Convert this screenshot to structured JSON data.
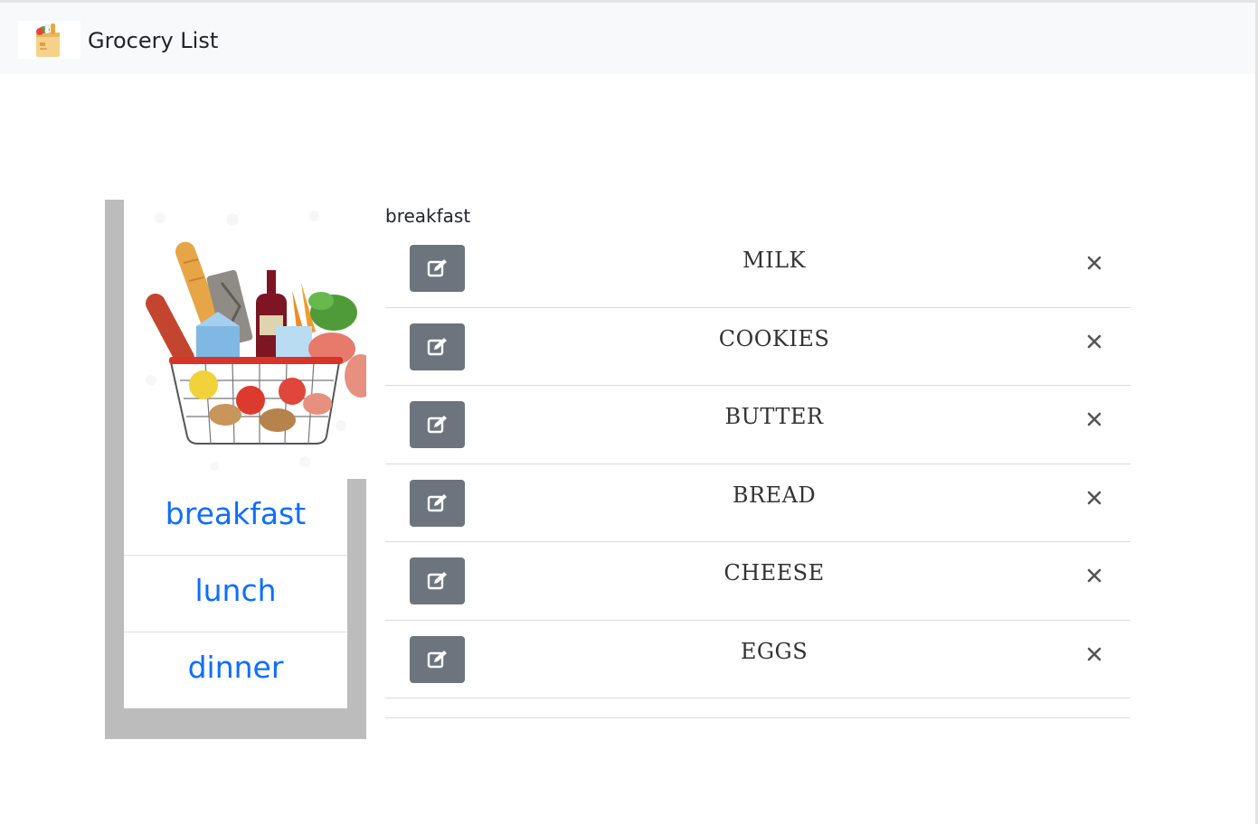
{
  "app": {
    "title": "Grocery List"
  },
  "sidebar": {
    "categories": [
      {
        "label": "breakfast"
      },
      {
        "label": "lunch"
      },
      {
        "label": "dinner"
      }
    ]
  },
  "main": {
    "list_title": "breakfast",
    "items": [
      {
        "name": "MILK"
      },
      {
        "name": "COOKIES"
      },
      {
        "name": "BUTTER"
      },
      {
        "name": "BREAD"
      },
      {
        "name": "CHEESE"
      },
      {
        "name": "EGGS"
      }
    ]
  },
  "colors": {
    "navbar_bg": "#f8f9fa",
    "sidebar_frame": "#bcbcbc",
    "link": "#0d6efd",
    "edit_button": "#6c757d",
    "delete_icon": "#555555"
  },
  "icons": {
    "brand": "grocery-bag-icon",
    "edit": "edit-icon",
    "delete": "close-icon"
  }
}
